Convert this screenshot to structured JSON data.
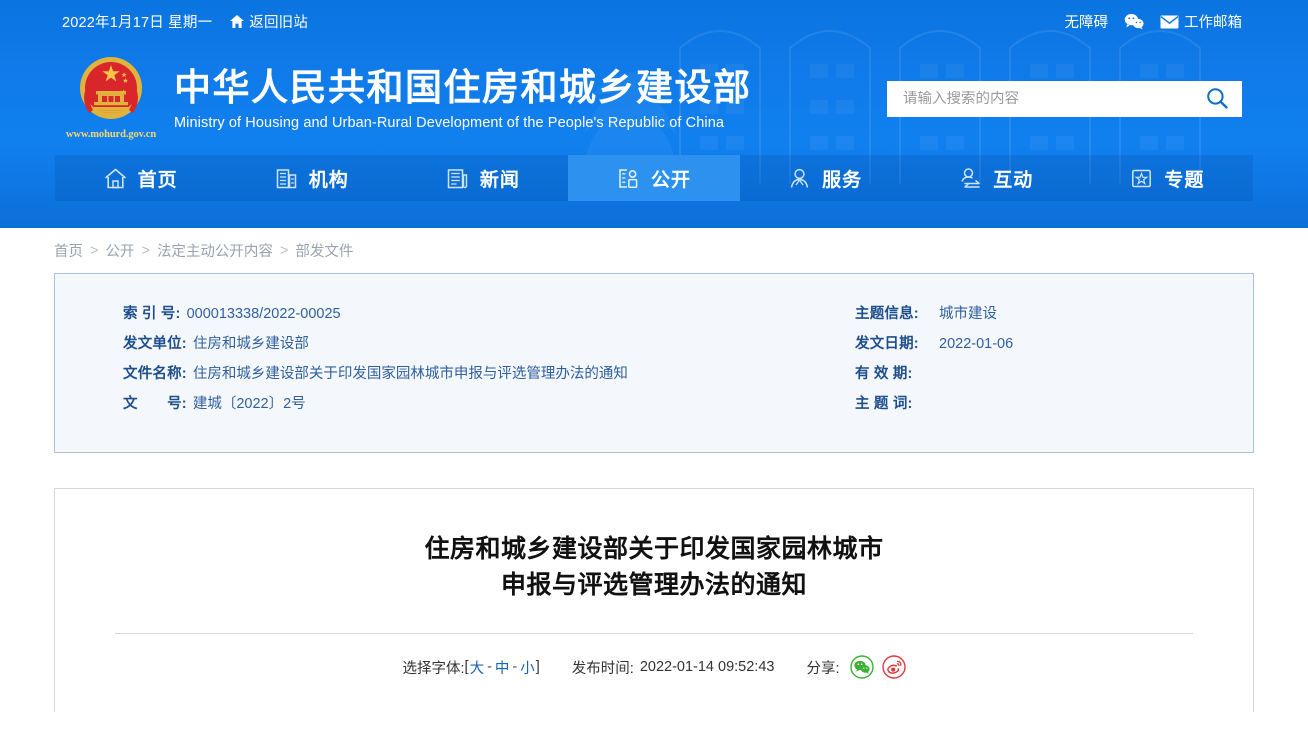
{
  "topbar": {
    "date": "2022年1月17日 星期一",
    "old_site": "返回旧站",
    "accessibility": "无障碍",
    "wechat_icon": "wechat-icon",
    "mail_icon": "mail-icon",
    "work_mail": "工作邮箱"
  },
  "brand": {
    "title_cn": "中华人民共和国住房和城乡建设部",
    "title_en": "Ministry of Housing and Urban-Rural Development of the People's Republic of China",
    "url": "www.mohurd.gov.cn",
    "emblem_icon": "national-emblem-icon"
  },
  "search": {
    "placeholder": "请输入搜索的内容",
    "value": "",
    "icon": "search-icon"
  },
  "nav": {
    "items": [
      {
        "label": "首页",
        "icon": "home-icon",
        "active": false
      },
      {
        "label": "机构",
        "icon": "building-icon",
        "active": false
      },
      {
        "label": "新闻",
        "icon": "news-icon",
        "active": false
      },
      {
        "label": "公开",
        "icon": "open-document-icon",
        "active": true
      },
      {
        "label": "服务",
        "icon": "service-person-icon",
        "active": false
      },
      {
        "label": "互动",
        "icon": "interaction-icon",
        "active": false
      },
      {
        "label": "专题",
        "icon": "star-topic-icon",
        "active": false
      }
    ]
  },
  "breadcrumb": {
    "items": [
      "首页",
      "公开",
      "法定主动公开内容",
      "部发文件"
    ],
    "separator": ">"
  },
  "meta": {
    "left": [
      {
        "label": "索 引 号:",
        "value": "000013338/2022-00025",
        "spacing": "sp1"
      },
      {
        "label": "发文单位:",
        "value": "住房和城乡建设部",
        "spacing": ""
      },
      {
        "label": "文件名称:",
        "value": "住房和城乡建设部关于印发国家园林城市申报与评选管理办法的通知",
        "spacing": ""
      },
      {
        "label": "文　　号:",
        "value": "建城〔2022〕2号",
        "spacing": "sp2"
      }
    ],
    "right": [
      {
        "label": "主题信息:",
        "value": "城市建设",
        "spacing": ""
      },
      {
        "label": "发文日期:",
        "value": "2022-01-06",
        "spacing": ""
      },
      {
        "label": "有 效 期:",
        "value": "",
        "spacing": "sp1"
      },
      {
        "label": "主 题 词:",
        "value": "",
        "spacing": "sp1"
      }
    ]
  },
  "article": {
    "title_line1": "住房和城乡建设部关于印发国家园林城市",
    "title_line2": "申报与评选管理办法的通知",
    "font_label": "选择字体:",
    "font_bracket_open": "[",
    "font_bracket_close": "]",
    "font_options": [
      "大",
      "中",
      "小"
    ],
    "font_dash": "-",
    "publish_label": "发布时间:",
    "publish_time": "2022-01-14 09:52:43",
    "share_label": "分享:",
    "share_icons": [
      "wechat-share-icon",
      "weibo-share-icon"
    ]
  },
  "colors": {
    "header_blue": "#0f7ae8",
    "nav_active": "#2d91f0",
    "meta_bg": "#f4f8fd",
    "meta_border": "#a8c4e0",
    "meta_label": "#1f4e8c",
    "link_blue": "#1763b8",
    "breadcrumb_gray": "#9aa3b0",
    "emblem_gold": "#f5d76e"
  }
}
